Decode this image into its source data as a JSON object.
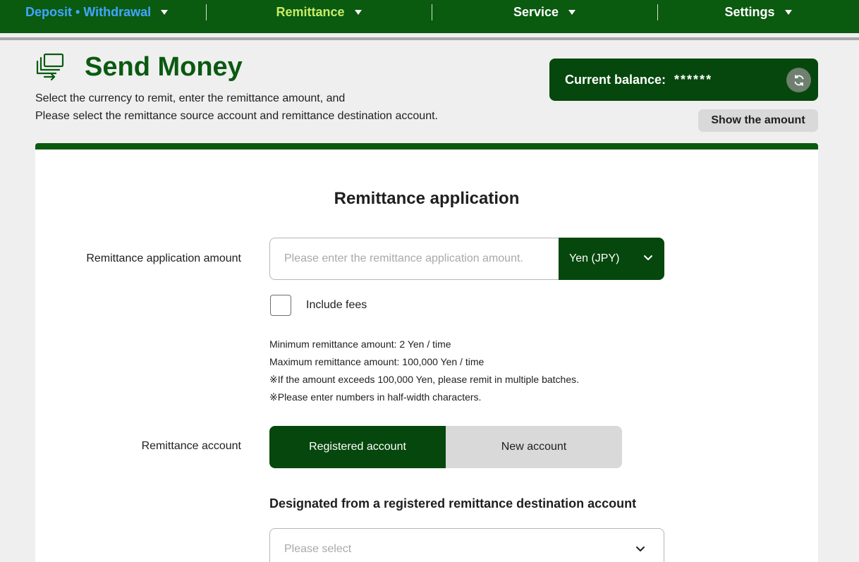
{
  "nav": {
    "items": [
      {
        "label": "Deposit • Withdrawal",
        "color": "#42a5ff"
      },
      {
        "label": "Remittance",
        "color": "#c6ec6a"
      },
      {
        "label": "Service",
        "color": "#ffffff"
      },
      {
        "label": "Settings",
        "color": "#ffffff"
      }
    ]
  },
  "header": {
    "title": "Send Money",
    "title_icon": "money-transfer-icon",
    "desc_line1": "Select the currency to remit, enter the remittance amount, and",
    "desc_line2": "Please select the remittance source account and remittance destination account."
  },
  "balance": {
    "label": "Current balance:",
    "masked_value": "******",
    "refresh_icon": "refresh-icon",
    "show_amount_label": "Show the amount"
  },
  "form": {
    "title": "Remittance application",
    "amount_label": "Remittance application amount",
    "amount_placeholder": "Please enter the remittance application amount.",
    "amount_value": "",
    "currency": "Yen (JPY)",
    "include_fees_label": "Include fees",
    "include_fees_checked": false,
    "notes": [
      "Minimum remittance amount: 2 Yen / time",
      "Maximum remittance amount: 100,000 Yen / time",
      "※If the amount exceeds 100,000 Yen, please remit in multiple batches.",
      "※Please enter numbers in half-width characters."
    ],
    "account_label": "Remittance account",
    "account_options": [
      "Registered account",
      "New account"
    ],
    "account_selected": "Registered account",
    "destination_heading": "Designated from a registered remittance destination account",
    "destination_placeholder": "Please select"
  },
  "colors": {
    "primary_green": "#0a5a10",
    "dark_green": "#05470c",
    "page_bg": "#efefef"
  }
}
